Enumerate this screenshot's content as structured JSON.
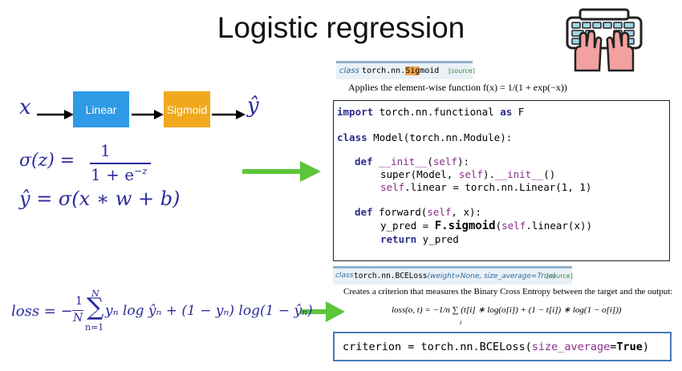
{
  "slide": {
    "title": "Logistic regression"
  },
  "flow": {
    "input": "x",
    "linear_label": "Linear",
    "sigmoid_label": "Sigmoid",
    "output": "ŷ",
    "linear_color": "#2f9be6",
    "sigmoid_color": "#f0a91d"
  },
  "equations": {
    "sigma_lhs": "σ(z) =",
    "sigma_num": "1",
    "sigma_den": "1 + e",
    "sigma_exp": "−z",
    "yhat": "ŷ = σ(x ∗ w + b)",
    "loss_lhs": "loss = −",
    "loss_frac_num": "1",
    "loss_frac_den": "N",
    "sum_top": "N",
    "sum_bottom": "n=1",
    "loss_rhs": "yₙ log ŷₙ + (1 − yₙ) log(1 − ŷₙ)"
  },
  "doc_sigmoid": {
    "kw": "class",
    "name_before": "torch.nn.",
    "name_hl": "Sig",
    "name_after": "moid",
    "source": "[source]",
    "desc": "Applies the element-wise function f(x) = 1/(1 + exp(−x))"
  },
  "code": {
    "l1_kw": "import",
    "l1_a": " torch.nn.functional ",
    "l1_kw2": "as",
    "l1_b": " F",
    "l2_kw": "class",
    "l2_a": " Model(torch.nn.Module):",
    "l3_kw": "def",
    "l3_fn": "__init__",
    "l3_a": "(",
    "l3_self": "self",
    "l3_b": "):",
    "l4_a": "super(Model, ",
    "l4_self": "self",
    "l4_b": ").",
    "l4_fn": "__init__",
    "l4_c": "()",
    "l5_self": "self",
    "l5_a": ".linear = torch.nn.Linear(1, 1)",
    "l6_kw": "def",
    "l6_a": " forward(",
    "l6_self": "self",
    "l6_b": ", x):",
    "l7_a": "y_pred = ",
    "l7_bold": "F.sigmoid",
    "l7_b": "(",
    "l7_self": "self",
    "l7_c": ".linear(x))",
    "l8_kw": "return",
    "l8_a": " y_pred"
  },
  "doc_bce": {
    "kw": "class",
    "name": "torch.nn.BCELoss",
    "params": "(weight=None, size_average=True)",
    "source": "[source]",
    "desc": "Creates a criterion that measures the Binary Cross Entropy between the target and the output:",
    "formula": "loss(o, t) = −1/n ∑ (t[i] ∗ log(o[i]) + (1 − t[i]) ∗ log(1 − o[i]))",
    "formula_sub": "i"
  },
  "criterion": {
    "a": "criterion = torch.nn.BCELoss(",
    "param": "size_average",
    "eq": "=",
    "val": "True",
    "close": ")"
  },
  "colors": {
    "arrow_green": "#5cc63a",
    "math_blue": "#2b2b9c",
    "box_border": "#4a78b8"
  },
  "icons": {
    "keyboard": "hands-on-keyboard-icon"
  }
}
